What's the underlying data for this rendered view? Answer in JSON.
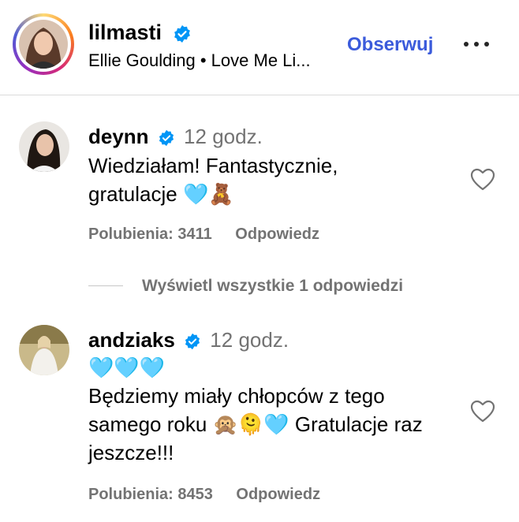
{
  "post_header": {
    "username": "lilmasti",
    "subtitle": "Ellie Goulding • Love Me Li...",
    "follow_label": "Obserwuj"
  },
  "comments": [
    {
      "username": "deynn",
      "time": "12 godz.",
      "text_line1": "Wiedziałam! Fantastycznie,",
      "text_line2": "gratulacje 🩵🧸",
      "likes": "Polubienia: 3411",
      "reply_label": "Odpowiedz"
    },
    {
      "username": "andziaks",
      "time": "12 godz.",
      "text_line1": "🩵🩵🩵",
      "text_line2": "Będziemy miały chłopców z tego",
      "text_line3": "samego roku 🙊🫠🩵 Gratulacje raz",
      "text_line4": "jeszcze!!!",
      "likes": "Polubienia: 8453",
      "reply_label": "Odpowiedz"
    }
  ],
  "view_replies_label": "Wyświetl wszystkie 1 odpowiedzi",
  "colors": {
    "accent": "#3b5bdb",
    "verified": "#0095f6",
    "muted": "#737373"
  }
}
